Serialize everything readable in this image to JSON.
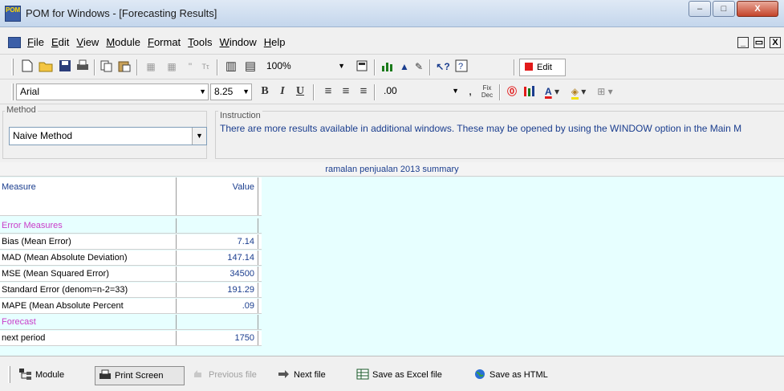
{
  "window": {
    "title": "POM for Windows - [Forecasting Results]",
    "app_icon_text": "POM"
  },
  "window_controls": {
    "minimize": "–",
    "maximize": "□",
    "close": "X"
  },
  "menu": [
    "File",
    "Edit",
    "View",
    "Module",
    "Format",
    "Tools",
    "Window",
    "Help"
  ],
  "mdi_controls": {
    "minimize": "_",
    "restore": "▭",
    "close": "X"
  },
  "toolbar1": {
    "zoom": "100%",
    "edit_label": "Edit"
  },
  "toolbar2": {
    "font": "Arial",
    "size": "8.25",
    "decimals": ".00",
    "comma": ",",
    "fix_dec": "Fix Dec"
  },
  "method": {
    "label": "Method",
    "value": "Naive Method"
  },
  "instruction": {
    "label": "Instruction",
    "text": "There are more results available in additional windows. These may be opened by using the WINDOW option in the Main M"
  },
  "summary": {
    "title": "ramalan penjualan 2013 summary",
    "header": {
      "measure": "Measure",
      "value": "Value"
    },
    "rows": [
      {
        "label": "Error Measures",
        "value": "",
        "kind": "section"
      },
      {
        "label": "Bias (Mean Error)",
        "value": "7.14",
        "kind": "data"
      },
      {
        "label": "MAD (Mean Absolute Deviation)",
        "value": "147.14",
        "kind": "data"
      },
      {
        "label": "MSE (Mean Squared Error)",
        "value": "34500",
        "kind": "data"
      },
      {
        "label": "Standard Error (denom=n-2=33)",
        "value": "191.29",
        "kind": "data"
      },
      {
        "label": "MAPE (Mean Absolute Percent",
        "value": ".09",
        "kind": "data"
      },
      {
        "label": "Forecast",
        "value": "",
        "kind": "section"
      },
      {
        "label": "next period",
        "value": "1750",
        "kind": "data"
      }
    ]
  },
  "bottom_buttons": {
    "module": "Module",
    "print_screen": "Print Screen",
    "previous_file": "Previous file",
    "next_file": "Next file",
    "save_excel": "Save as Excel file",
    "save_html": "Save as HTML"
  },
  "colors": {
    "content_bg": "#e7ffff",
    "label_blue": "#1a3d8e",
    "section_magenta": "#c93cc9"
  }
}
